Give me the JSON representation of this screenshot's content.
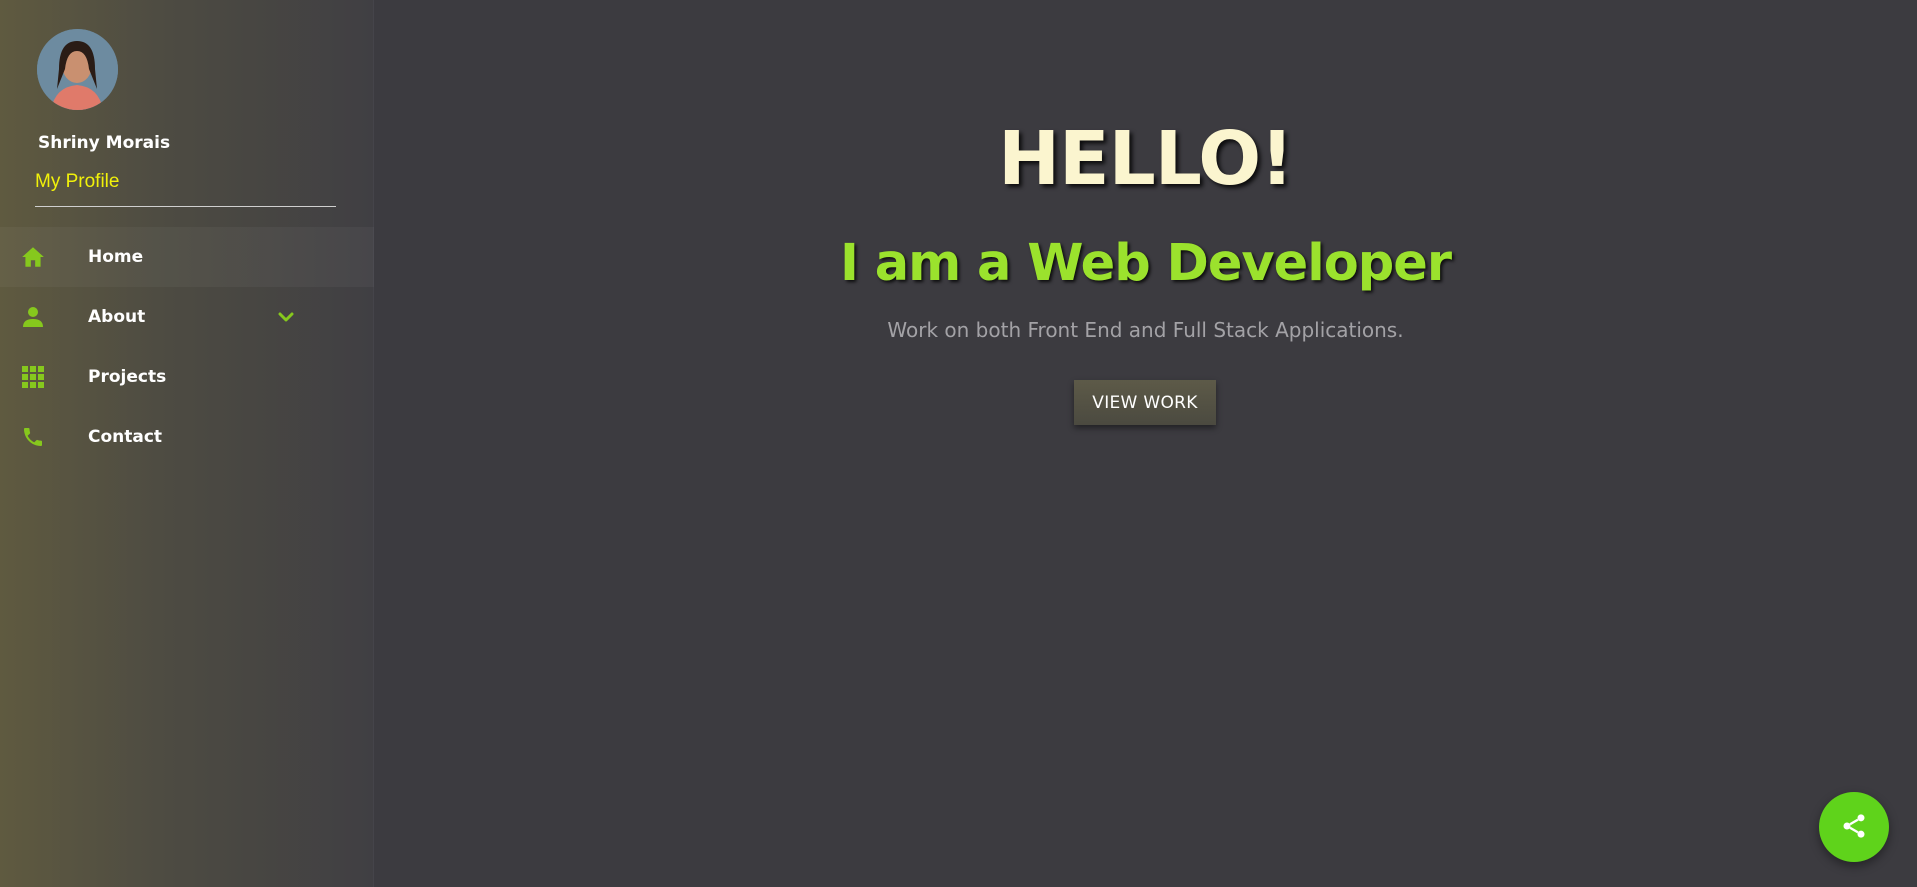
{
  "sidebar": {
    "user_name": "Shriny Morais",
    "profile_link": "My Profile",
    "items": [
      {
        "label": "Home",
        "icon": "home-icon"
      },
      {
        "label": "About",
        "icon": "person-icon"
      },
      {
        "label": "Projects",
        "icon": "grid-icon"
      },
      {
        "label": "Contact",
        "icon": "phone-icon"
      }
    ]
  },
  "hero": {
    "greeting": "HELLO!",
    "role": "I am a Web Developer",
    "description": "Work on both Front End and Full Stack Applications.",
    "cta_label": "VIEW WORK"
  },
  "fab": {
    "icon": "share-icon"
  },
  "colors": {
    "accent": "#9be22d",
    "profile_link": "#f1f10a",
    "hello": "#fbf5cf",
    "fab": "#5fd31b",
    "background": "#3c3b40"
  }
}
